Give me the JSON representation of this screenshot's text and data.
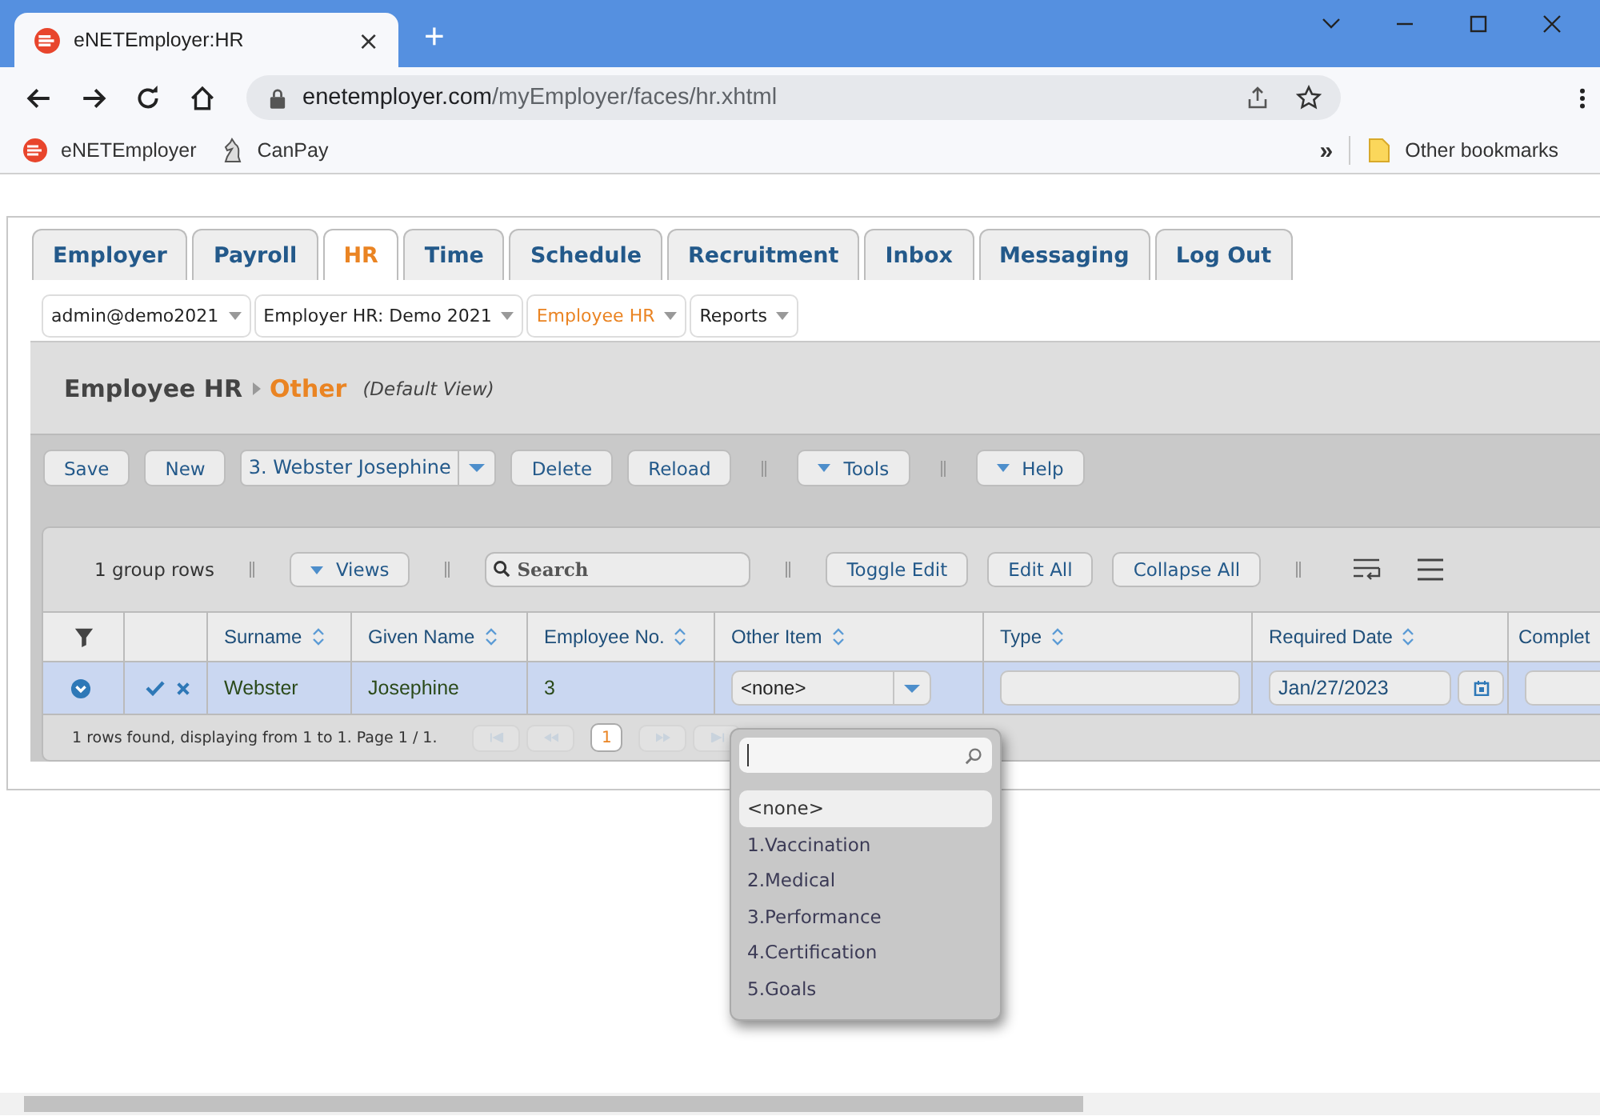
{
  "browser": {
    "tab_title": "eNETEmployer:HR",
    "tab_close": "×",
    "new_tab": "+",
    "url_host": "enetemployer.com",
    "url_path": "/myEmployer/faces/hr.xhtml",
    "bookmarks": [
      {
        "label": "eNETEmployer",
        "kind": "enet"
      },
      {
        "label": "CanPay",
        "kind": "canpay"
      }
    ],
    "more_bookmarks": "»",
    "other_bookmarks": "Other bookmarks"
  },
  "tabs": [
    {
      "label": "Employer",
      "selected": false
    },
    {
      "label": "Payroll",
      "selected": false
    },
    {
      "label": "HR",
      "selected": true
    },
    {
      "label": "Time",
      "selected": false
    },
    {
      "label": "Schedule",
      "selected": false
    },
    {
      "label": "Recruitment",
      "selected": false
    },
    {
      "label": "Inbox",
      "selected": false
    },
    {
      "label": "Messaging",
      "selected": false
    },
    {
      "label": "Log Out",
      "selected": false
    }
  ],
  "menus": [
    {
      "label": "admin@demo2021",
      "selected": false
    },
    {
      "label": "Employer HR: Demo 2021",
      "selected": false
    },
    {
      "label": "Employee HR",
      "selected": true
    },
    {
      "label": "Reports",
      "selected": false
    }
  ],
  "breadcrumb": {
    "parent": "Employee HR",
    "current": "Other",
    "view": "(Default View)"
  },
  "toolbar": [
    {
      "kind": "button",
      "label": "Save"
    },
    {
      "kind": "button",
      "label": "New"
    },
    {
      "kind": "select",
      "label": "3. Webster Josephine"
    },
    {
      "kind": "button",
      "label": "Delete"
    },
    {
      "kind": "button",
      "label": "Reload"
    },
    {
      "kind": "separator"
    },
    {
      "kind": "menu",
      "label": "Tools"
    },
    {
      "kind": "separator"
    },
    {
      "kind": "menu",
      "label": "Help"
    }
  ],
  "grid": {
    "group_rows": "1 group rows",
    "views": "Views",
    "search_placeholder": "Search",
    "buttons": [
      "Toggle Edit",
      "Edit All",
      "Collapse All"
    ],
    "columns": [
      {
        "kind": "filter"
      },
      {
        "kind": "blank"
      },
      {
        "kind": "sortable",
        "label": "Surname"
      },
      {
        "kind": "sortable",
        "label": "Given Name"
      },
      {
        "kind": "sortable",
        "label": "Employee No."
      },
      {
        "kind": "sortable",
        "label": "Other Item"
      },
      {
        "kind": "sortable",
        "label": "Type"
      },
      {
        "kind": "sortable",
        "label": "Required Date"
      },
      {
        "kind": "plain",
        "label": "Complet"
      }
    ],
    "row": {
      "selected": true,
      "cells": [
        {
          "kind": "expand"
        },
        {
          "kind": "actions"
        },
        {
          "kind": "text",
          "value": "Webster"
        },
        {
          "kind": "text",
          "value": "Josephine"
        },
        {
          "kind": "text",
          "value": "3"
        },
        {
          "kind": "select",
          "value": "<none>"
        },
        {
          "kind": "input"
        },
        {
          "kind": "date",
          "value": "Jan/27/2023"
        },
        {
          "kind": "input"
        }
      ]
    },
    "footer": "1 rows found, displaying from 1 to 1. Page 1 / 1.",
    "page": "1",
    "dropdown": {
      "options": [
        {
          "label": "<none>",
          "selected": true
        },
        {
          "label": "1.Vaccination",
          "selected": false
        },
        {
          "label": "2.Medical",
          "selected": false
        },
        {
          "label": "3.Performance",
          "selected": false
        },
        {
          "label": "4.Certification",
          "selected": false
        },
        {
          "label": "5.Goals",
          "selected": false
        }
      ]
    }
  }
}
